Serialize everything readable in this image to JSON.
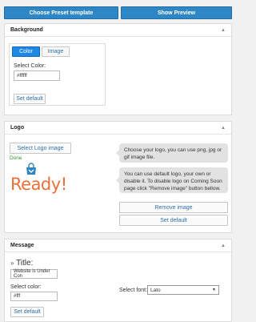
{
  "toolbar": {
    "preset_label": "Choose Preset template",
    "preview_label": "Show Preview"
  },
  "background": {
    "title": "Background",
    "tabs": [
      "Color",
      "Image"
    ],
    "select_color_label": "Select Color:",
    "color_value": "#ffffff",
    "set_default_label": "Set default"
  },
  "logo": {
    "title": "Logo",
    "select_logo_label": "Select Logo image",
    "done_label": "Done",
    "tip1": "Choose your logo, you can use png, jpg or gif image file.",
    "tip2": "You can use default logo, your own or disable it. To disable logo on Coming Soon page click \"Remove image\" button bellow.",
    "logo_text": "Ready!",
    "remove_label": "Remove image",
    "set_default_label": "Set default"
  },
  "message": {
    "title": "Message",
    "title_label": "Title:",
    "title_value": "Website is Under Con",
    "select_color_label": "Select color:",
    "color_value": "#fff",
    "select_font_label": "Select font:",
    "font_value": "Lato",
    "set_default_label": "Set default"
  },
  "colors": {
    "accent": "#2e87c4",
    "tab_active": "#1e88e5",
    "logo_orange": "#e8703a",
    "logo_blue": "#2e86c1",
    "done_green": "#2e9a2e"
  }
}
